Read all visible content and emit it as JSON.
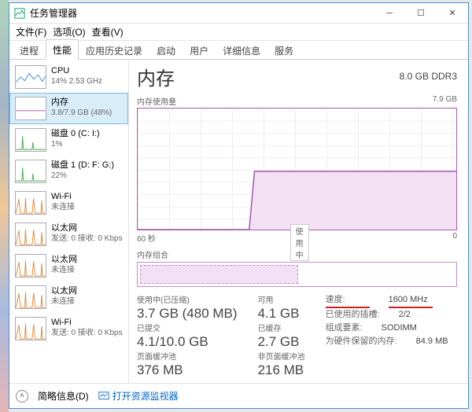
{
  "window": {
    "title": "任务管理器"
  },
  "menu": [
    "文件(F)",
    "选项(O)",
    "查看(V)"
  ],
  "tabs": [
    "进程",
    "性能",
    "应用历史记录",
    "启动",
    "用户",
    "详细信息",
    "服务"
  ],
  "active_tab": 1,
  "sidebar": {
    "items": [
      {
        "title": "CPU",
        "sub": "14% 2.53 GHz",
        "color": "#3a8edb"
      },
      {
        "title": "内存",
        "sub": "3.8/7.9 GB (48%)",
        "color": "#9b4fb0",
        "active": true
      },
      {
        "title": "磁盘 0 (C: I:)",
        "sub": "1%",
        "color": "#3fae3f"
      },
      {
        "title": "磁盘 1 (D: F: G:)",
        "sub": "22%",
        "color": "#3fae3f"
      },
      {
        "title": "Wi-Fi",
        "sub": "未连接",
        "color": "#e0893a"
      },
      {
        "title": "以太网",
        "sub": "发送: 0 接收: 0 Kbps",
        "color": "#e0893a"
      },
      {
        "title": "以太网",
        "sub": "未连接",
        "color": "#e0893a"
      },
      {
        "title": "以太网",
        "sub": "未连接",
        "color": "#e0893a"
      },
      {
        "title": "Wi-Fi",
        "sub": "发送: 0 接收: 0 Kbps",
        "color": "#e0893a"
      }
    ]
  },
  "main": {
    "title": "内存",
    "capacity": "8.0 GB DDR3",
    "chart_label": "内存使用量",
    "chart_max": "7.9 GB",
    "axis_left": "60 秒",
    "axis_mid": "使用中",
    "axis_right": "0",
    "slots_label": "内存组合"
  },
  "stats": {
    "left": [
      {
        "label": "使用中(已压缩)",
        "value": "3.7 GB (480 MB)"
      },
      {
        "label": "已提交",
        "value": "4.1/10.0 GB"
      },
      {
        "label": "页面缓冲池",
        "value": "376 MB"
      }
    ],
    "mid": [
      {
        "label": "可用",
        "value": "4.1 GB"
      },
      {
        "label": "已缓存",
        "value": "2.7 GB"
      },
      {
        "label": "非页面缓冲池",
        "value": "216 MB"
      }
    ],
    "right": [
      {
        "label": "速度:",
        "value": "1600 MHz",
        "mark": true
      },
      {
        "label": "已使用的插槽:",
        "value": "2/2"
      },
      {
        "label": "组成要素:",
        "value": "SODIMM"
      },
      {
        "label": "为硬件保留的内存:",
        "value": "84.9 MB"
      }
    ]
  },
  "footer": {
    "brief": "简略信息(D)",
    "link": "打开资源监视器"
  },
  "chart_data": {
    "type": "area",
    "title": "内存使用量",
    "xlabel": "60 秒 → 0",
    "ylabel": "GB",
    "ylim": [
      0,
      7.9
    ],
    "x_seconds": [
      60,
      55,
      50,
      45,
      40,
      39,
      38,
      35,
      30,
      25,
      20,
      15,
      10,
      5,
      0
    ],
    "used_gb": [
      0.0,
      0.0,
      0.0,
      0.0,
      0.0,
      0.0,
      3.8,
      3.8,
      3.8,
      3.8,
      3.8,
      3.8,
      3.8,
      3.8,
      3.8
    ],
    "note": "内存使用量在约 38 秒前从 0 阶跃到 ~3.8 GB 并保持平稳"
  }
}
